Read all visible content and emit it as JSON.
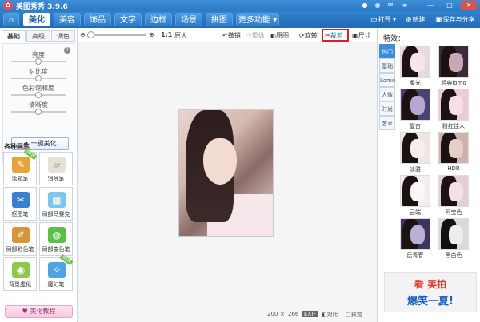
{
  "app": {
    "title": "美图秀秀 3.9.6"
  },
  "window_controls": {
    "minimize": "—",
    "maximize": "□",
    "close": "✕"
  },
  "nav": {
    "tabs": [
      "美化",
      "美容",
      "饰品",
      "文字",
      "边框",
      "场景",
      "拼图",
      "更多功能"
    ],
    "active": "美化",
    "open_label": "打开",
    "new_label": "新建",
    "save_label": "保存与分享"
  },
  "left": {
    "tabs": [
      "基础",
      "高级",
      "调色"
    ],
    "active_tab": "基础",
    "sliders": [
      {
        "label": "亮度",
        "value": 0.5
      },
      {
        "label": "对比度",
        "value": 0.5
      },
      {
        "label": "色彩饱和度",
        "value": 0.5
      },
      {
        "label": "清晰度",
        "value": 0.5
      }
    ],
    "one_key_label": "一键美化",
    "tools_title": "各种画笔",
    "tools": [
      {
        "label": "涂鸦笔",
        "badge": "NEW"
      },
      {
        "label": "消除笔",
        "badge": ""
      },
      {
        "label": "抠图笔",
        "badge": ""
      },
      {
        "label": "局部马赛克",
        "badge": ""
      },
      {
        "label": "局部彩色笔",
        "badge": ""
      },
      {
        "label": "局部变色笔",
        "badge": ""
      },
      {
        "label": "背景虚化",
        "badge": ""
      },
      {
        "label": "魔幻笔",
        "badge": "NEW"
      }
    ],
    "tutorial_label": "美化教程"
  },
  "canvas": {
    "zoom_ratio": "1:1",
    "fit_label": "原大",
    "undo_label": "撤销",
    "redo_label": "重做",
    "original_label": "原图",
    "rotate_label": "旋转",
    "crop_label": "裁剪",
    "size_label": "尺寸",
    "width": "200",
    "times": "×",
    "height": "266",
    "exif_label": "EXIF",
    "compare_label": "对比",
    "preview_label": "预览"
  },
  "right": {
    "title": "特效：",
    "categories": [
      "热门",
      "基础",
      "Lomo",
      "人像",
      "时尚",
      "艺术"
    ],
    "active_category": "热门",
    "effects": [
      "柔光",
      "经典lomo",
      "复古",
      "粉红佳人",
      "淡雅",
      "HDR",
      "云端",
      "阿宝色",
      "后青春",
      "黑白色"
    ],
    "ad_line1": "看 美拍",
    "ad_line2": "爆笑一夏!"
  },
  "colors": {
    "accent": "#2c79c4",
    "crop_highlight": "#e02020"
  }
}
